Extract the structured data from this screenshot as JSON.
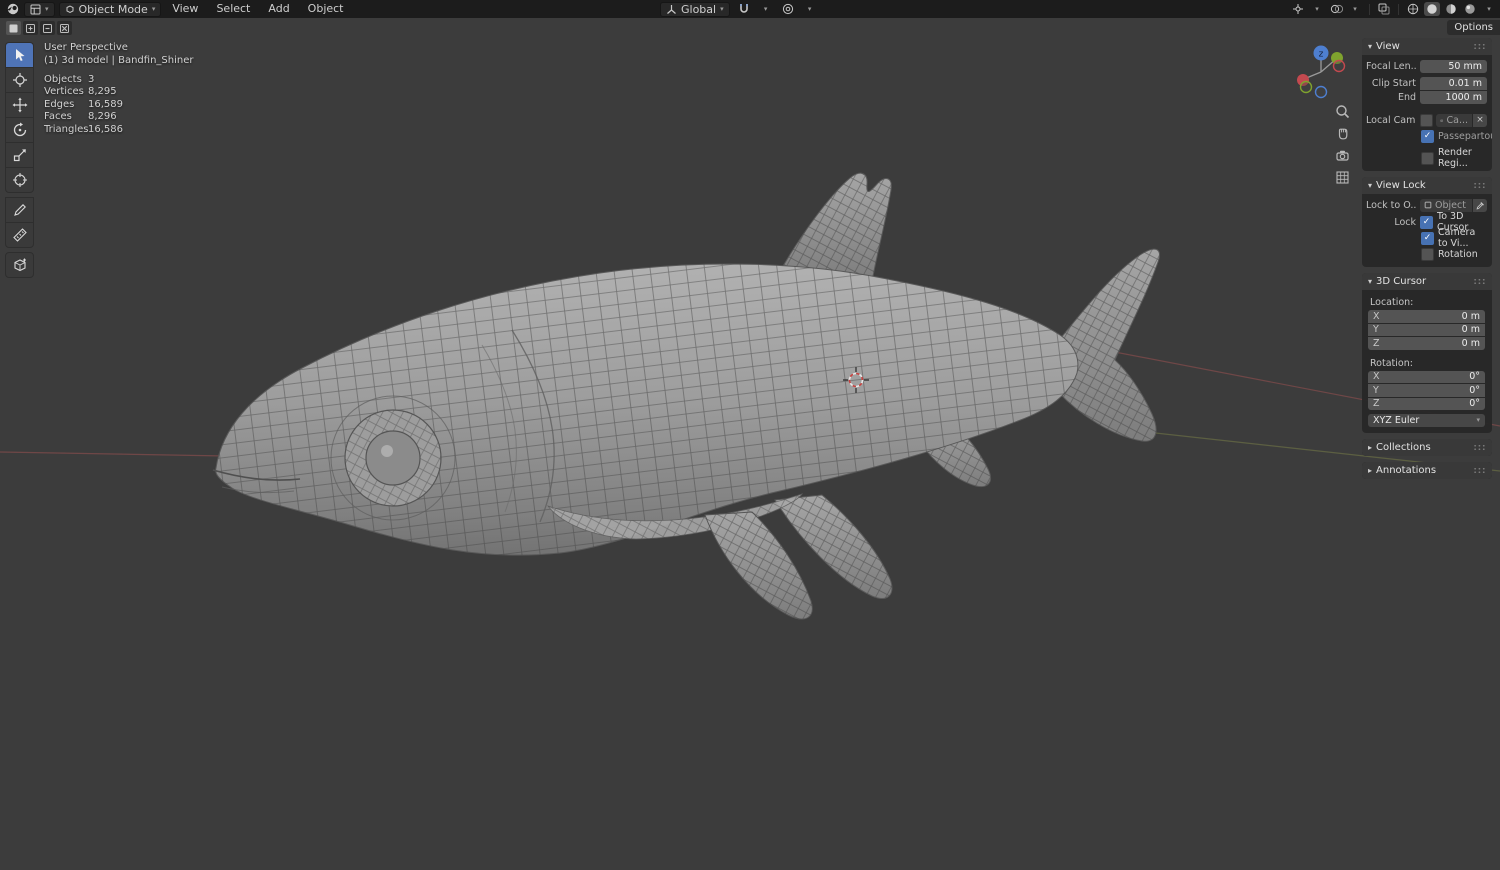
{
  "topbar": {
    "mode": "Object Mode",
    "menus": [
      "View",
      "Select",
      "Add",
      "Object"
    ],
    "orientation": "Global",
    "options_label": "Options"
  },
  "viewport": {
    "overlay": {
      "perspective": "User Perspective",
      "scene_info": "(1) 3d model | Bandfin_Shiner",
      "stats": [
        {
          "label": "Objects",
          "value": "3"
        },
        {
          "label": "Vertices",
          "value": "8,295"
        },
        {
          "label": "Edges",
          "value": "16,589"
        },
        {
          "label": "Faces",
          "value": "8,296"
        },
        {
          "label": "Triangles",
          "value": "16,586"
        }
      ]
    },
    "gizmo_axis_label": "z"
  },
  "sidebar": {
    "view": {
      "title": "View",
      "focal_label": "Focal Len...",
      "focal_value": "50 mm",
      "clip_start_label": "Clip Start",
      "clip_start_value": "0.01 m",
      "clip_end_label": "End",
      "clip_end_value": "1000 m",
      "local_camera_label": "Local Cam...",
      "local_camera_value": "Ca...",
      "passepartout_label": "Passepartout",
      "render_region_label": "Render Regi..."
    },
    "view_lock": {
      "title": "View Lock",
      "lock_to_label": "Lock to O...",
      "lock_to_value": "Object",
      "lock_label": "Lock",
      "options": [
        {
          "label": "To 3D Cursor",
          "checked": true
        },
        {
          "label": "Camera to Vi...",
          "checked": true
        },
        {
          "label": "Rotation",
          "checked": false
        }
      ]
    },
    "cursor3d": {
      "title": "3D Cursor",
      "location_label": "Location:",
      "location": [
        {
          "axis": "X",
          "value": "0 m"
        },
        {
          "axis": "Y",
          "value": "0 m"
        },
        {
          "axis": "Z",
          "value": "0 m"
        }
      ],
      "rotation_label": "Rotation:",
      "rotation": [
        {
          "axis": "X",
          "value": "0°"
        },
        {
          "axis": "Y",
          "value": "0°"
        },
        {
          "axis": "Z",
          "value": "0°"
        }
      ],
      "euler": "XYZ Euler"
    },
    "collections_title": "Collections",
    "annotations_title": "Annotations"
  },
  "icons": {
    "blender_logo": "blender-logo",
    "editor_type": "viewport-editor-icon",
    "snap": "magnet-icon",
    "proportional": "proportional-edit-icon",
    "shading": [
      "wireframe",
      "solid",
      "material-preview",
      "rendered"
    ],
    "nav": [
      "zoom",
      "pan-hand",
      "camera-view",
      "toggle-ortho"
    ]
  },
  "colors": {
    "accent": "#4772b3",
    "header_bg": "#1c1c1c",
    "viewport_bg": "#3c3c3c",
    "panel_bg": "#282828",
    "field_bg": "#545454"
  }
}
